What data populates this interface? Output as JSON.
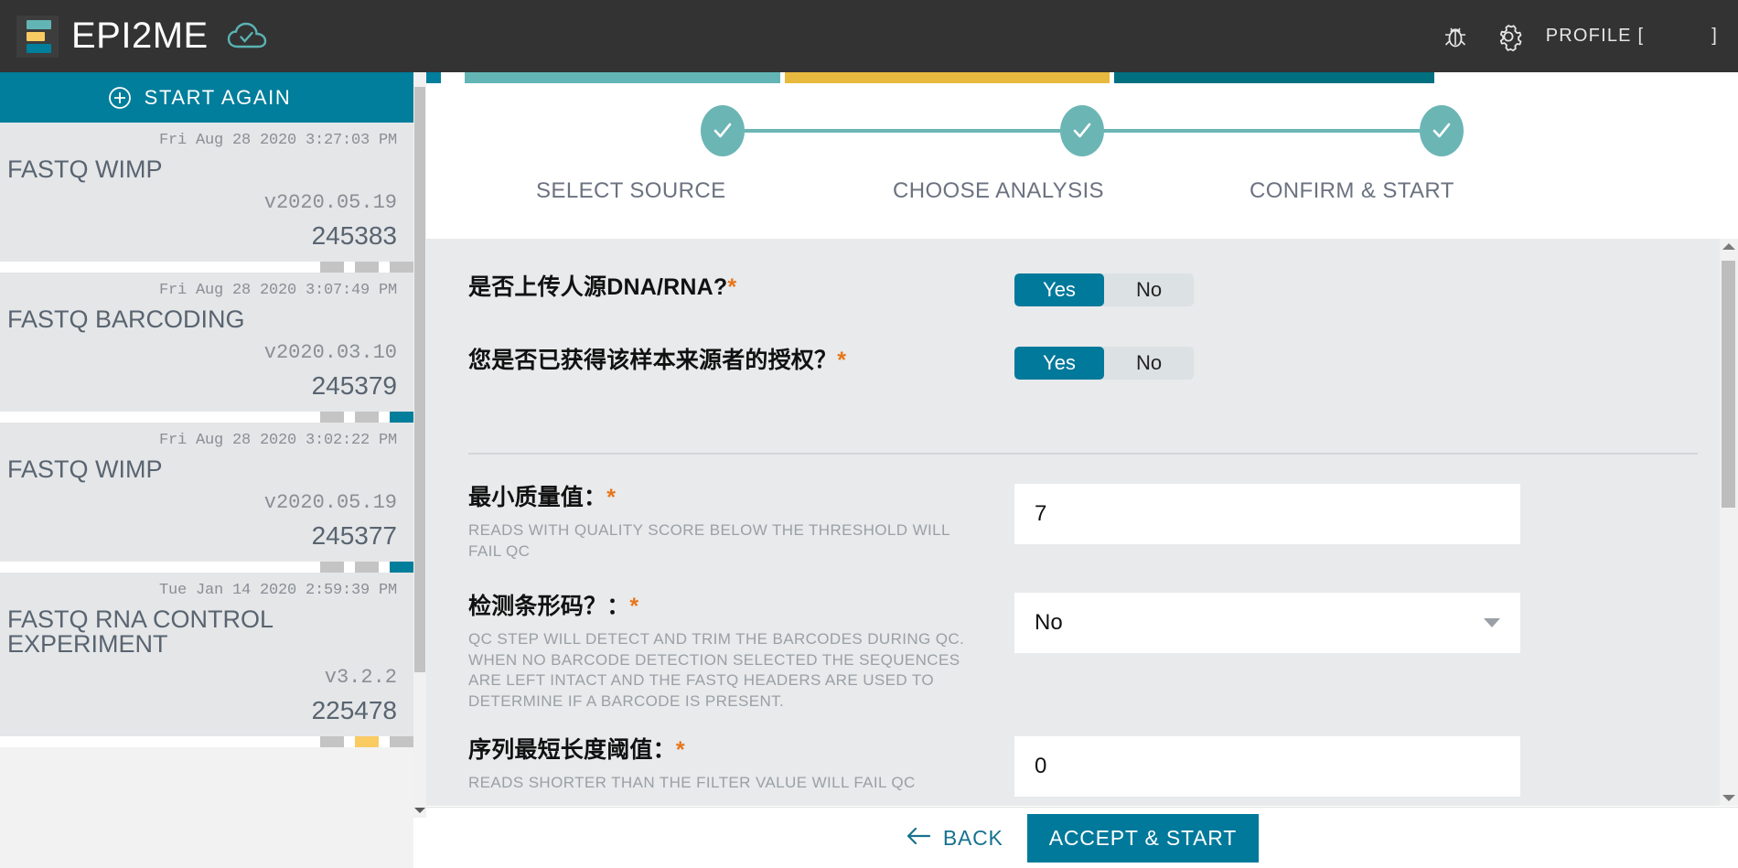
{
  "header": {
    "brand": "EPI2ME",
    "cloud_status_icon": "cloud-check-icon",
    "bug_icon": "bug-icon",
    "gear_icon": "gear-icon",
    "profile_prefix": "PROFILE [",
    "profile_suffix": "]"
  },
  "sidebar": {
    "start_again_label": "START AGAIN",
    "jobs": [
      {
        "date": "Fri Aug 28 2020 3:27:03 PM",
        "name": "FASTQ WIMP",
        "version": "v2020.05.19",
        "id": "245383",
        "segments": [
          "grey",
          "grey",
          "grey"
        ]
      },
      {
        "date": "Fri Aug 28 2020 3:07:49 PM",
        "name": "FASTQ BARCODING",
        "version": "v2020.03.10",
        "id": "245379",
        "segments": [
          "grey",
          "grey",
          "teal"
        ]
      },
      {
        "date": "Fri Aug 28 2020 3:02:22 PM",
        "name": "FASTQ WIMP",
        "version": "v2020.05.19",
        "id": "245377",
        "segments": [
          "grey",
          "grey",
          "teal"
        ]
      },
      {
        "date": "Tue Jan 14 2020 2:59:39 PM",
        "name": "FASTQ RNA CONTROL EXPERIMENT",
        "version": "v3.2.2",
        "id": "225478",
        "segments": [
          "grey",
          "yellow",
          "grey"
        ]
      }
    ]
  },
  "stepper": {
    "steps": [
      {
        "label": "SELECT SOURCE",
        "state": "complete"
      },
      {
        "label": "CHOOSE ANALYSIS",
        "state": "complete"
      },
      {
        "label": "CONFIRM & START",
        "state": "complete"
      }
    ]
  },
  "form": {
    "questions": [
      {
        "label": "是否上传人源DNA/RNA?",
        "required_mark": "*",
        "yes_label": "Yes",
        "no_label": "No",
        "selected": "Yes"
      },
      {
        "label": "您是否已获得该样本来源者的授权？",
        "required_mark": "*",
        "yes_label": "Yes",
        "no_label": "No",
        "selected": "Yes"
      }
    ],
    "fields": [
      {
        "label": "最小质量值：",
        "required_mark": "*",
        "help": "READS WITH QUALITY SCORE BELOW THE THRESHOLD WILL FAIL QC",
        "type": "text",
        "value": "7"
      },
      {
        "label": "检测条形码？：",
        "required_mark": "*",
        "help": "QC STEP WILL DETECT AND TRIM THE BARCODES DURING QC. WHEN NO BARCODE DETECTION SELECTED THE SEQUENCES ARE LEFT INTACT AND THE FASTQ HEADERS ARE USED TO DETERMINE IF A BARCODE IS PRESENT.",
        "type": "select",
        "value": "No"
      },
      {
        "label": "序列最短长度阈值：",
        "required_mark": "*",
        "help": "READS SHORTER THAN THE FILTER VALUE WILL FAIL QC",
        "type": "text",
        "value": "0"
      }
    ]
  },
  "actions": {
    "back_label": "BACK",
    "accept_label": "ACCEPT & START"
  },
  "colors": {
    "brand_teal": "#007e9b",
    "step_teal": "#6cb5b5",
    "accent_yellow": "#f9cb62",
    "required_orange": "#e8751a",
    "header_dark": "#333333",
    "form_bg": "#e8eaeb"
  }
}
